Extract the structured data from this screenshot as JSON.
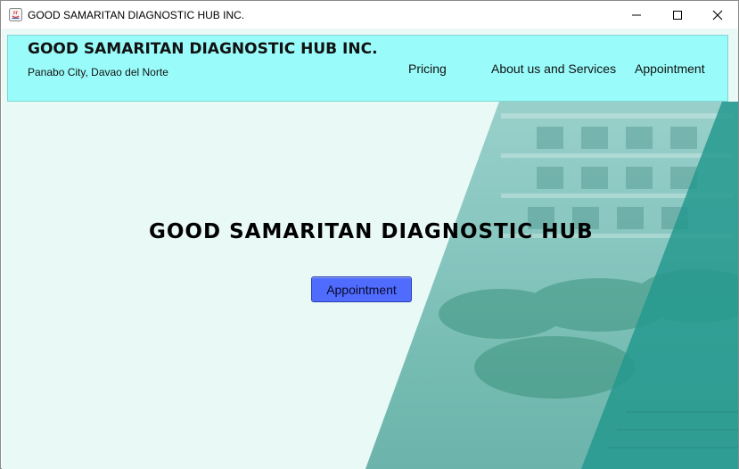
{
  "window": {
    "title": "GOOD SAMARITAN DIAGNOSTIC HUB INC.",
    "controls": [
      "minimize-icon",
      "maximize-icon",
      "close-icon"
    ]
  },
  "header": {
    "brand": "GOOD SAMARITAN DIAGNOSTIC HUB INC.",
    "location": "Panabo City, Davao del Norte",
    "nav": {
      "pricing": "Pricing",
      "about": "About us and Services",
      "appointment": "Appointment"
    }
  },
  "hero": {
    "title": "GOOD SAMARITAN DIAGNOSTIC HUB",
    "button_label": "Appointment"
  },
  "colors": {
    "header_bg": "#99fcfa",
    "client_bg": "#e9f9f6",
    "button_bg": "#4f6cff",
    "teal_overlay": "#2fa9a0"
  }
}
